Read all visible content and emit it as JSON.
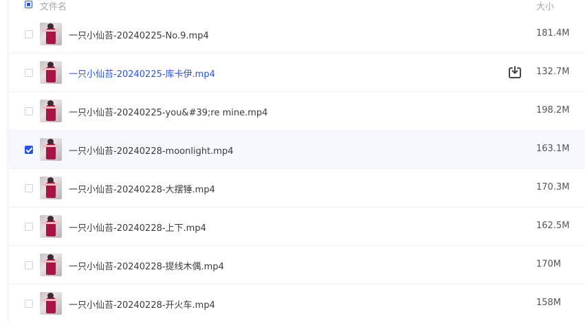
{
  "header": {
    "name_label": "文件名",
    "size_label": "大小"
  },
  "files": [
    {
      "name": "一只小仙苔-20240225-No.9.mp4",
      "size": "181.4M",
      "checked": false,
      "hover": false
    },
    {
      "name": "一只小仙苔-20240225-库卡伊.mp4",
      "size": "132.7M",
      "checked": false,
      "hover": true
    },
    {
      "name": "一只小仙苔-20240225-you&#39;re mine.mp4",
      "size": "198.2M",
      "checked": false,
      "hover": false
    },
    {
      "name": "一只小仙苔-20240228-moonlight.mp4",
      "size": "163.1M",
      "checked": true,
      "hover": false
    },
    {
      "name": "一只小仙苔-20240228-大摆锤.mp4",
      "size": "170.3M",
      "checked": false,
      "hover": false
    },
    {
      "name": "一只小仙苔-20240228-上下.mp4",
      "size": "162.5M",
      "checked": false,
      "hover": false
    },
    {
      "name": "一只小仙苔-20240228-提线木偶.mp4",
      "size": "170M",
      "checked": false,
      "hover": false
    },
    {
      "name": "一只小仙苔-20240228-开火车.mp4",
      "size": "158M",
      "checked": false,
      "hover": false
    }
  ],
  "icons": {
    "download": "download-icon",
    "thumbnail": "video-thumbnail"
  },
  "colors": {
    "accent": "#2556e6",
    "selected_row_bg": "#f7f8fe",
    "header_text": "#a3a7ad"
  }
}
